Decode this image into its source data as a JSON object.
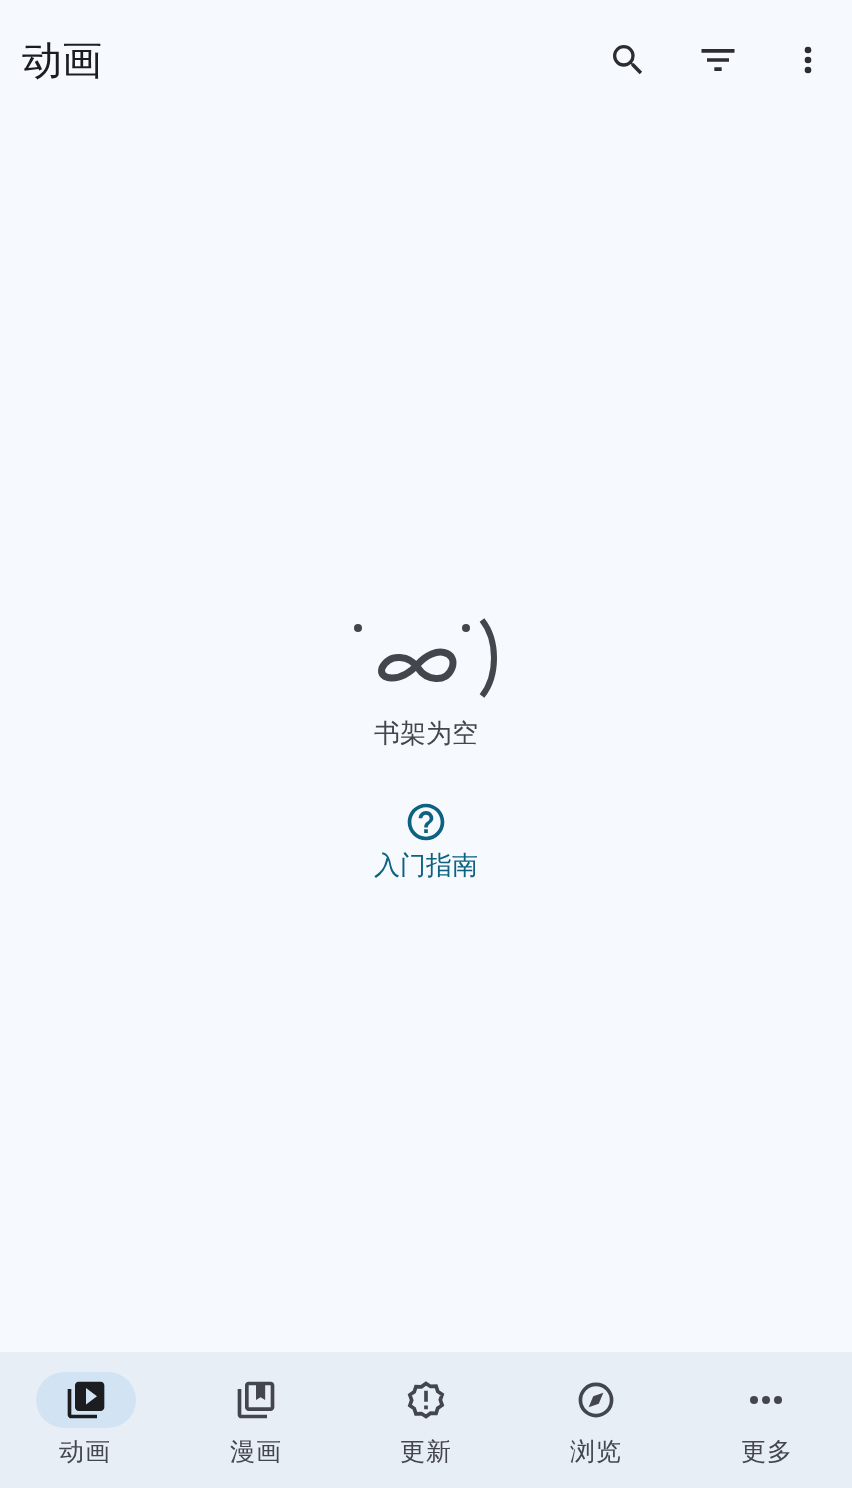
{
  "top_bar": {
    "title": "动画"
  },
  "empty_state": {
    "message": "书架为空",
    "help_link": "入门指南"
  },
  "bottom_nav": [
    {
      "label": "动画",
      "selected": true
    },
    {
      "label": "漫画",
      "selected": false
    },
    {
      "label": "更新",
      "selected": false
    },
    {
      "label": "浏览",
      "selected": false
    },
    {
      "label": "更多",
      "selected": false
    }
  ]
}
